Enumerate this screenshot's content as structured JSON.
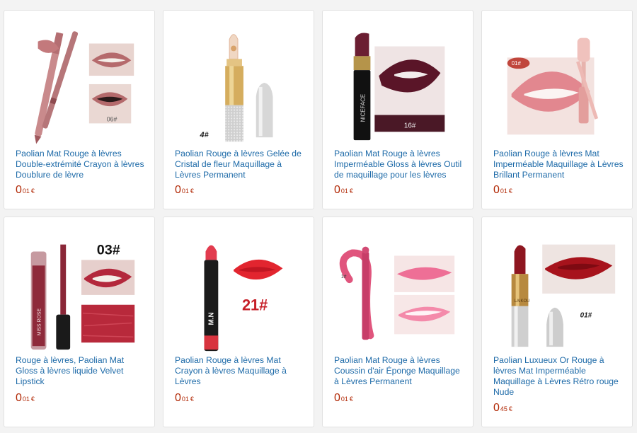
{
  "products": [
    {
      "title": "Paolian Mat Rouge à lèvres Double-extrémité Crayon à lèvres Doublure de lèvre",
      "price_int": "0",
      "price_cents": "01",
      "currency": "€",
      "image_label": "06#"
    },
    {
      "title": "Paolian Rouge à lèvres Gelée de Cristal de fleur Maquillage à Lèvres Permanent",
      "price_int": "0",
      "price_cents": "01",
      "currency": "€",
      "image_label": "4#"
    },
    {
      "title": "Paolian Mat Rouge à lèvres Imperméable Gloss à lèvres Outil de maquillage pour les lèvres",
      "price_int": "0",
      "price_cents": "01",
      "currency": "€",
      "image_label": "16#"
    },
    {
      "title": "Paolian Rouge à lèvres Mat Imperméable Maquillage à Lèvres Brillant Permanent",
      "price_int": "0",
      "price_cents": "01",
      "currency": "€",
      "image_label": "01#"
    },
    {
      "title": "Rouge à lèvres, Paolian Mat Gloss à lèvres liquide Velvet Lipstick",
      "price_int": "0",
      "price_cents": "01",
      "currency": "€",
      "image_label": "03#"
    },
    {
      "title": "Paolian Rouge à lèvres Mat Crayon à lèvres Maquillage à Lèvres",
      "price_int": "0",
      "price_cents": "01",
      "currency": "€",
      "image_label": "21#"
    },
    {
      "title": "Paolian Mat Rouge à lèvres Coussin d'air Éponge Maquillage à Lèvres Permanent",
      "price_int": "0",
      "price_cents": "01",
      "currency": "€",
      "image_label": "1#"
    },
    {
      "title": "Paolian Luxueux Or Rouge à lèvres Mat Imperméable Maquillage à Lèvres Rétro rouge Nude",
      "price_int": "0",
      "price_cents": "45",
      "currency": "€",
      "image_label": "01#"
    }
  ],
  "brand_marks": {
    "p3": "NICEFACE",
    "p5": "MISS ROSE",
    "p6": "M.N",
    "p8": "LAIKOU"
  },
  "colors": {
    "link": "#1d6aa8",
    "price": "#b12704",
    "card_border": "#e2e2e2",
    "page_bg": "#f3f3f3"
  }
}
